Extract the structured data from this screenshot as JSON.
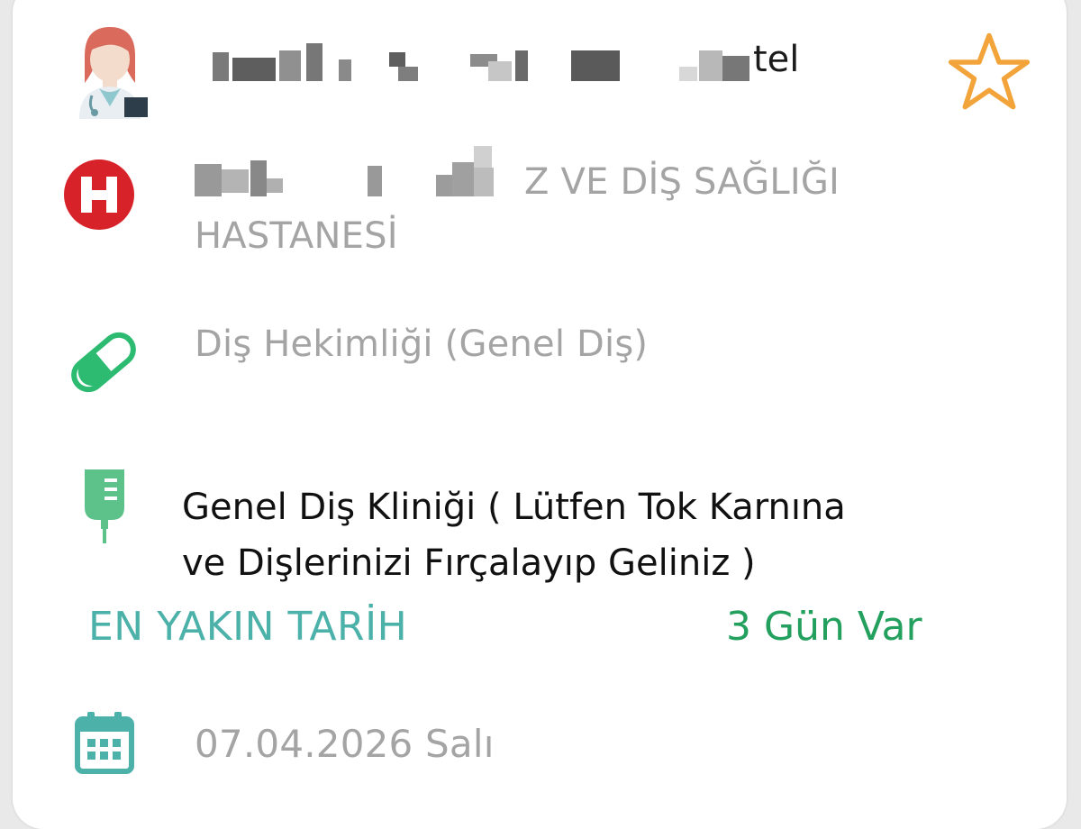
{
  "doctor": {
    "name_redacted": "████ █ ██ █ █ ███ ███tel",
    "favorite_icon": "star-outline-icon",
    "favorite_color": "#f2a43a"
  },
  "hospital": {
    "name_line1_tail": "Z VE DİŞ SAĞLIĞI",
    "name_line2": "HASTANESİ",
    "icon": "hospital-h-icon",
    "icon_color": "#d62228"
  },
  "department": {
    "label": "Diş Hekimliği (Genel Diş)",
    "icon": "pill-capsule-icon",
    "icon_color": "#2dbb72"
  },
  "clinic": {
    "label_line1": "Genel Diş Kliniği ( Lütfen Tok Karnına",
    "label_line2": "ve Dişlerinizi Fırçalayıp Geliniz )",
    "icon": "iv-bag-icon",
    "icon_color": "#5cc28a"
  },
  "nearest": {
    "label": "EN YAKIN TARİH",
    "countdown": "3 Gün Var",
    "label_color": "#4bb1a9",
    "countdown_color": "#23a05e"
  },
  "date": {
    "value": "07.04.2026 Salı",
    "icon": "calendar-icon",
    "icon_color": "#4bb1a9"
  }
}
